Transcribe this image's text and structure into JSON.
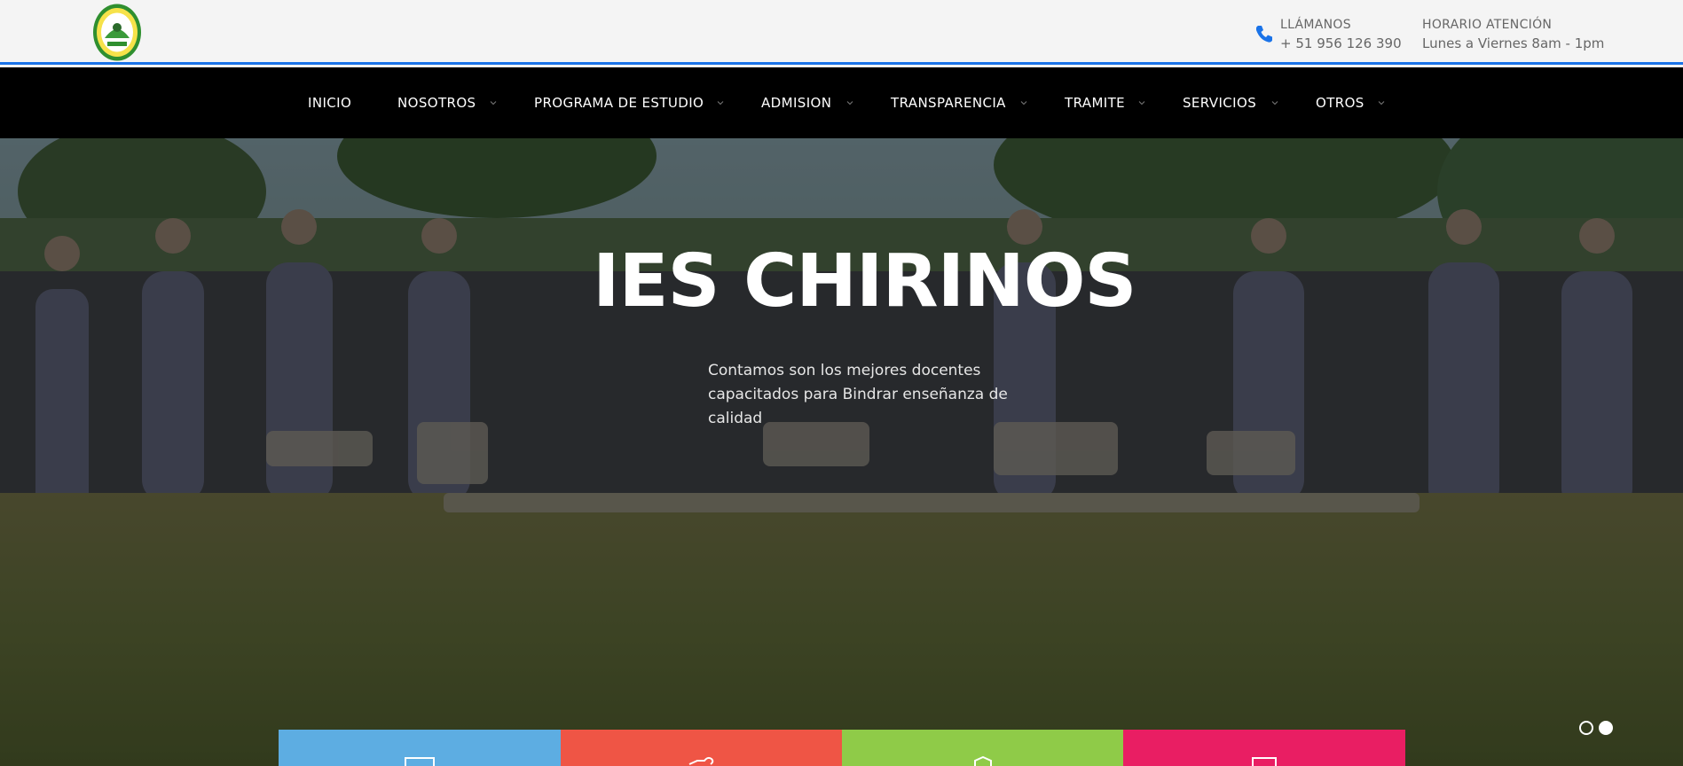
{
  "header": {
    "logo_icon": "institution-seal-logo",
    "phone": {
      "label": "LLÁMANOS",
      "value": "+ 51 956 126 390",
      "icon": "phone-icon"
    },
    "hours": {
      "label": "HORARIO ATENCIÓN",
      "value": "Lunes a Viernes 8am - 1pm"
    },
    "accent_color": "#1a73e8"
  },
  "nav": {
    "items": [
      {
        "label": "INICIO",
        "dropdown": false
      },
      {
        "label": "NOSOTROS",
        "dropdown": true
      },
      {
        "label": "PROGRAMA DE ESTUDIO",
        "dropdown": true
      },
      {
        "label": "ADMISION",
        "dropdown": true
      },
      {
        "label": "TRANSPARENCIA",
        "dropdown": true
      },
      {
        "label": "TRAMITE",
        "dropdown": true
      },
      {
        "label": "SERVICIOS",
        "dropdown": true
      },
      {
        "label": "OTROS",
        "dropdown": true
      }
    ]
  },
  "hero": {
    "title": "IES CHIRINOS",
    "text": "Contamos son los mejores docentes capacitados para Bindrar enseñanza de calidad",
    "slides": {
      "count": 2,
      "active": 2
    }
  },
  "tiles": [
    {
      "color": "#5dade2",
      "icon": "screen-icon"
    },
    {
      "color": "#ef5545",
      "icon": "heart-hands-icon"
    },
    {
      "color": "#8fcb48",
      "icon": "shield-icon"
    },
    {
      "color": "#e91e63",
      "icon": "monitor-icon"
    }
  ]
}
